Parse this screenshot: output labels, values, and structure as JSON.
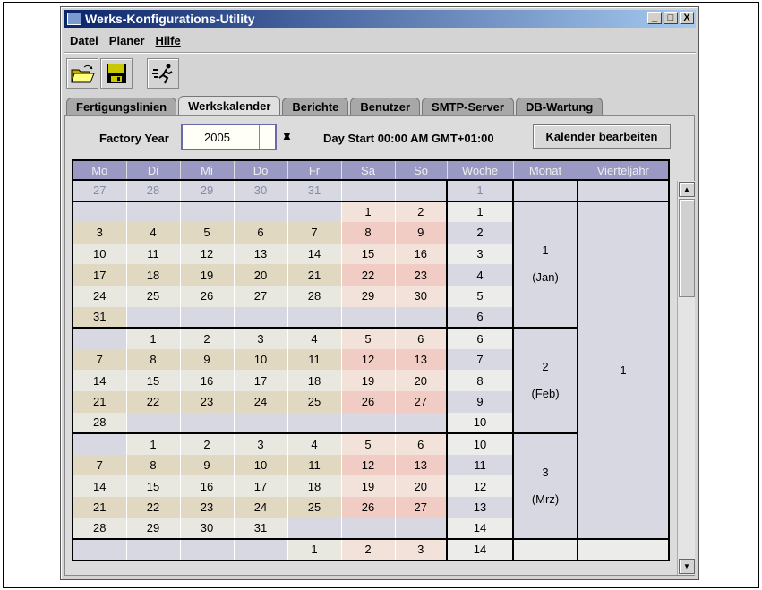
{
  "window": {
    "title": "Werks-Konfigurations-Utility",
    "min": "_",
    "max": "□",
    "close": "X"
  },
  "menu": [
    {
      "label": "Datei"
    },
    {
      "label": "Planer"
    },
    {
      "label": "Hilfe"
    }
  ],
  "toolbar": {
    "open": "open-folder-icon",
    "save": "save-disk-icon",
    "run": "running-man-icon"
  },
  "tabs": [
    {
      "label": "Fertigungslinien"
    },
    {
      "label": "Werkskalender",
      "active": true
    },
    {
      "label": "Berichte"
    },
    {
      "label": "Benutzer"
    },
    {
      "label": "SMTP-Server"
    },
    {
      "label": "DB-Wartung"
    }
  ],
  "controls": {
    "year_label": "Factory Year",
    "year_value": "2005",
    "day_start": "Day Start 00:00 AM GMT+01:00",
    "edit_button": "Kalender bearbeiten"
  },
  "calendar": {
    "headers": [
      "Mo",
      "Di",
      "Mi",
      "Do",
      "Fr",
      "Sa",
      "So",
      "Woche",
      "Monat",
      "Vierteljahr"
    ],
    "prev_row": {
      "days": [
        "27",
        "28",
        "29",
        "30",
        "31",
        "",
        ""
      ],
      "week": "1"
    },
    "months": [
      {
        "num": "1",
        "name": "(Jan)",
        "rows": [
          {
            "days": [
              "",
              "",
              "",
              "",
              "",
              "1",
              "2"
            ],
            "week": "1"
          },
          {
            "days": [
              "3",
              "4",
              "5",
              "6",
              "7",
              "8",
              "9"
            ],
            "week": "2"
          },
          {
            "days": [
              "10",
              "11",
              "12",
              "13",
              "14",
              "15",
              "16"
            ],
            "week": "3"
          },
          {
            "days": [
              "17",
              "18",
              "19",
              "20",
              "21",
              "22",
              "23"
            ],
            "week": "4"
          },
          {
            "days": [
              "24",
              "25",
              "26",
              "27",
              "28",
              "29",
              "30"
            ],
            "week": "5"
          },
          {
            "days": [
              "31",
              "",
              "",
              "",
              "",
              "",
              ""
            ],
            "week": "6"
          }
        ]
      },
      {
        "num": "2",
        "name": "(Feb)",
        "rows": [
          {
            "days": [
              "",
              "1",
              "2",
              "3",
              "4",
              "5",
              "6"
            ],
            "week": "6"
          },
          {
            "days": [
              "7",
              "8",
              "9",
              "10",
              "11",
              "12",
              "13"
            ],
            "week": "7"
          },
          {
            "days": [
              "14",
              "15",
              "16",
              "17",
              "18",
              "19",
              "20"
            ],
            "week": "8"
          },
          {
            "days": [
              "21",
              "22",
              "23",
              "24",
              "25",
              "26",
              "27"
            ],
            "week": "9"
          },
          {
            "days": [
              "28",
              "",
              "",
              "",
              "",
              "",
              ""
            ],
            "week": "10"
          }
        ]
      },
      {
        "num": "3",
        "name": "(Mrz)",
        "rows": [
          {
            "days": [
              "",
              "1",
              "2",
              "3",
              "4",
              "5",
              "6"
            ],
            "week": "10"
          },
          {
            "days": [
              "7",
              "8",
              "9",
              "10",
              "11",
              "12",
              "13"
            ],
            "week": "11"
          },
          {
            "days": [
              "14",
              "15",
              "16",
              "17",
              "18",
              "19",
              "20"
            ],
            "week": "12"
          },
          {
            "days": [
              "21",
              "22",
              "23",
              "24",
              "25",
              "26",
              "27"
            ],
            "week": "13"
          },
          {
            "days": [
              "28",
              "29",
              "30",
              "31",
              "",
              "",
              ""
            ],
            "week": "14"
          }
        ]
      }
    ],
    "quarter": "1",
    "next_row": {
      "days": [
        "",
        "",
        "",
        "",
        "1",
        "2",
        "3"
      ],
      "week": "14"
    }
  }
}
